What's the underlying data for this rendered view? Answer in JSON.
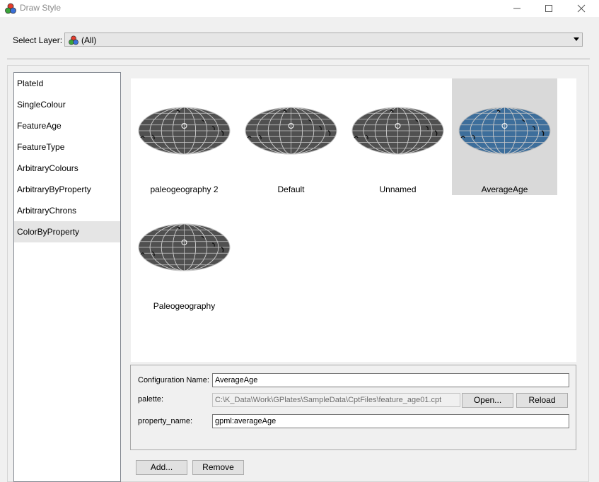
{
  "window": {
    "title": "Draw Style"
  },
  "select_layer": {
    "label": "Select Layer:",
    "value": "(All)"
  },
  "styles_list": [
    {
      "label": "PlateId",
      "selected": false
    },
    {
      "label": "SingleColour",
      "selected": false
    },
    {
      "label": "FeatureAge",
      "selected": false
    },
    {
      "label": "FeatureType",
      "selected": false
    },
    {
      "label": "ArbitraryColours",
      "selected": false
    },
    {
      "label": "ArbitraryByProperty",
      "selected": false
    },
    {
      "label": "ArbitraryChrons",
      "selected": false
    },
    {
      "label": "ColorByProperty",
      "selected": true
    }
  ],
  "gallery": [
    {
      "caption": "paleogeography 2",
      "color": "#505050",
      "selected": false
    },
    {
      "caption": "Default",
      "color": "#505050",
      "selected": false
    },
    {
      "caption": "Unnamed",
      "color": "#505050",
      "selected": false
    },
    {
      "caption": "AverageAge",
      "color": "#3d6e9b",
      "selected": true
    },
    {
      "caption": "Paleogeography",
      "color": "#505050",
      "selected": false
    }
  ],
  "config": {
    "name_label": "Configuration Name:",
    "name_value": "AverageAge",
    "palette_label": "palette:",
    "palette_value": "C:\\K_Data\\Work\\GPlates\\SampleData\\CptFiles\\feature_age01.cpt",
    "open_label": "Open...",
    "reload_label": "Reload",
    "property_label": "property_name:",
    "property_value": "gpml:averageAge"
  },
  "buttons": {
    "add_label": "Add...",
    "remove_label": "Remove"
  }
}
